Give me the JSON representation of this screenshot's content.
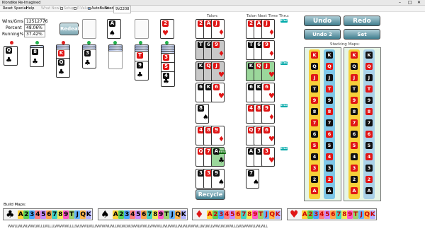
{
  "window": {
    "title": "Klondike Re-Imagined"
  },
  "menu": {
    "items": [
      "Reset",
      "Special",
      "Help"
    ],
    "what_now": "What Now?",
    "setup": "Setup",
    "p_value": "P-Value",
    "autobuild": "AutoBuild",
    "seed_label": "Seed:",
    "seed_value": "9V2208"
  },
  "stats": {
    "wins_label": "Wins/Gms",
    "wins_value": "12512776",
    "percent_label": "Percent",
    "percent_value": "48.06%",
    "running_label": "Running%",
    "running_value": "37.42%"
  },
  "buttons": {
    "redeal": "Redeal",
    "undo": "Undo",
    "redo": "Redo",
    "undo_moves": "Undo 2 Moves",
    "set_checkpoint": "Set Checkpoint",
    "recycle": "Recycle"
  },
  "labels": {
    "talon": "Talon:",
    "talon_next": "Talon Next Time Thru:",
    "stacking_maps": "Stacking Maps:",
    "build_maps": "Build Maps:",
    "stack_tag": "STACK",
    "build_tag": "BUILD"
  },
  "foundation": [
    {
      "rank": "A",
      "suit": "♠",
      "color": "blk"
    },
    {
      "rank": "2",
      "suit": "♥",
      "color": "red"
    }
  ],
  "tableau_faceup": [
    {
      "rank": "Q",
      "suit": "♣",
      "color": "blk"
    },
    {
      "rank": "8",
      "suit": "♣",
      "color": "blk"
    },
    {
      "rank": "K",
      "suit": "♥",
      "color": "red"
    },
    {
      "rank": "Q",
      "suit": "♣",
      "color": "blk"
    },
    {
      "rank": "3",
      "suit": "♣",
      "color": "blk"
    },
    {
      "rank": "T",
      "suit": "♦",
      "color": "red"
    },
    {
      "rank": "9",
      "suit": "♣",
      "color": "blk"
    },
    {
      "rank": "3",
      "suit": "♥",
      "color": "red"
    },
    {
      "rank": "5",
      "suit": "♦",
      "color": "red"
    },
    {
      "rank": "4",
      "suit": "♣",
      "color": "blk"
    }
  ],
  "talon_cards": [
    [
      "2",
      "♥",
      "red"
    ],
    [
      "A",
      "♦",
      "red"
    ],
    [
      "J",
      "♦",
      "red"
    ],
    [
      "T",
      "♣",
      "blk"
    ],
    [
      "6",
      "♠",
      "blk"
    ],
    [
      "9",
      "♦",
      "red"
    ],
    [
      "K",
      "♠",
      "blk"
    ],
    [
      "Q",
      "♦",
      "red"
    ],
    [
      "J",
      "♥",
      "red"
    ],
    [
      "6",
      "♠",
      "blk"
    ],
    [
      "K",
      "♣",
      "blk"
    ],
    [
      "6",
      "♥",
      "red"
    ],
    [
      "8",
      "♠",
      "blk"
    ],
    [
      "4",
      "♦",
      "red"
    ],
    [
      "8",
      "♥",
      "red"
    ],
    [
      "9",
      "♦",
      "red"
    ],
    [
      "Q",
      "♥",
      "red"
    ],
    [
      "7",
      "♦",
      "red"
    ],
    [
      "A",
      "♣",
      "blk"
    ],
    [
      "3",
      "♠",
      "blk"
    ],
    [
      "3",
      "♥",
      "red"
    ],
    [
      "9",
      "♠",
      "blk"
    ]
  ],
  "talon_next": [
    [
      "2",
      "♥",
      "red"
    ],
    [
      "A",
      "♦",
      "red"
    ],
    [
      "J",
      "♦",
      "red"
    ],
    [
      "T",
      "♣",
      "blk"
    ],
    [
      "6",
      "♠",
      "blk"
    ],
    [
      "9",
      "♦",
      "red"
    ],
    [
      "K",
      "♠",
      "blk"
    ],
    [
      "Q",
      "♦",
      "red"
    ],
    [
      "J",
      "♥",
      "red"
    ],
    [
      "6",
      "♠",
      "blk"
    ],
    [
      "K",
      "♣",
      "blk"
    ],
    [
      "6",
      "♥",
      "red"
    ],
    [
      "4",
      "♦",
      "red"
    ],
    [
      "8",
      "♥",
      "red"
    ],
    [
      "9",
      "♦",
      "red"
    ],
    [
      "Q",
      "♥",
      "red"
    ],
    [
      "7",
      "♦",
      "red"
    ],
    [
      "6",
      "♥",
      "red"
    ],
    [
      "A",
      "♣",
      "blk"
    ],
    [
      "3",
      "♠",
      "blk"
    ],
    [
      "3",
      "♥",
      "red"
    ],
    [
      "7",
      "♠",
      "blk"
    ]
  ],
  "stacking_maps": {
    "left": [
      [
        "K",
        "red"
      ],
      [
        "Q",
        "blk"
      ],
      [
        "J",
        "red"
      ],
      [
        "T",
        "blk"
      ],
      [
        "9",
        "red"
      ],
      [
        "8",
        "blk"
      ],
      [
        "7",
        "red"
      ],
      [
        "6",
        "blk"
      ],
      [
        "5",
        "red"
      ],
      [
        "4",
        "blk"
      ],
      [
        "3",
        "red"
      ],
      [
        "2",
        "blk"
      ],
      [
        "A",
        "red"
      ]
    ],
    "mid": [
      [
        "K",
        "blk"
      ],
      [
        "Q",
        "red"
      ],
      [
        "J",
        "blk"
      ],
      [
        "T",
        "red"
      ],
      [
        "9",
        "blk"
      ],
      [
        "8",
        "red"
      ],
      [
        "7",
        "blk"
      ],
      [
        "6",
        "red"
      ],
      [
        "5",
        "blk"
      ],
      [
        "4",
        "red"
      ],
      [
        "3",
        "blk"
      ],
      [
        "2",
        "red"
      ],
      [
        "A",
        "blk"
      ]
    ],
    "right": [
      [
        "K",
        "red"
      ],
      [
        "Q",
        "blk"
      ],
      [
        "J",
        "red"
      ],
      [
        "T",
        "blk"
      ],
      [
        "9",
        "red"
      ],
      [
        "8",
        "blk"
      ],
      [
        "7",
        "red"
      ],
      [
        "6",
        "blk"
      ],
      [
        "5",
        "red"
      ],
      [
        "4",
        "blk"
      ],
      [
        "3",
        "red"
      ],
      [
        "2",
        "blk"
      ],
      [
        "A",
        "red"
      ]
    ],
    "far": [
      [
        "K",
        "blk"
      ],
      [
        "Q",
        "red"
      ],
      [
        "J",
        "blk"
      ],
      [
        "T",
        "red"
      ],
      [
        "9",
        "blk"
      ],
      [
        "8",
        "red"
      ],
      [
        "7",
        "blk"
      ],
      [
        "6",
        "red"
      ],
      [
        "5",
        "blk"
      ],
      [
        "4",
        "red"
      ],
      [
        "3",
        "blk"
      ],
      [
        "2",
        "red"
      ],
      [
        "A",
        "blk"
      ]
    ]
  },
  "build_maps": [
    {
      "suit": "♣",
      "color": "blk",
      "seq": "A23456789TJQK"
    },
    {
      "suit": "♠",
      "color": "blk",
      "seq": "A23456789TJQK"
    },
    {
      "suit": "♦",
      "color": "red",
      "seq": "A23456789TJQK"
    },
    {
      "suit": "♥",
      "color": "red",
      "seq": "A23456789TJQK"
    }
  ],
  "wl_string": "WWLLWLWLWWLWLLLWLLLLWWWWLLLLWLWWLWLLWWWWLWLLWLWLWLWWLWWLLWWWLLWLWWLLWLWLWWWLLWLWLLWWLWLWWLLLWLWWWLLWLWLL"
}
